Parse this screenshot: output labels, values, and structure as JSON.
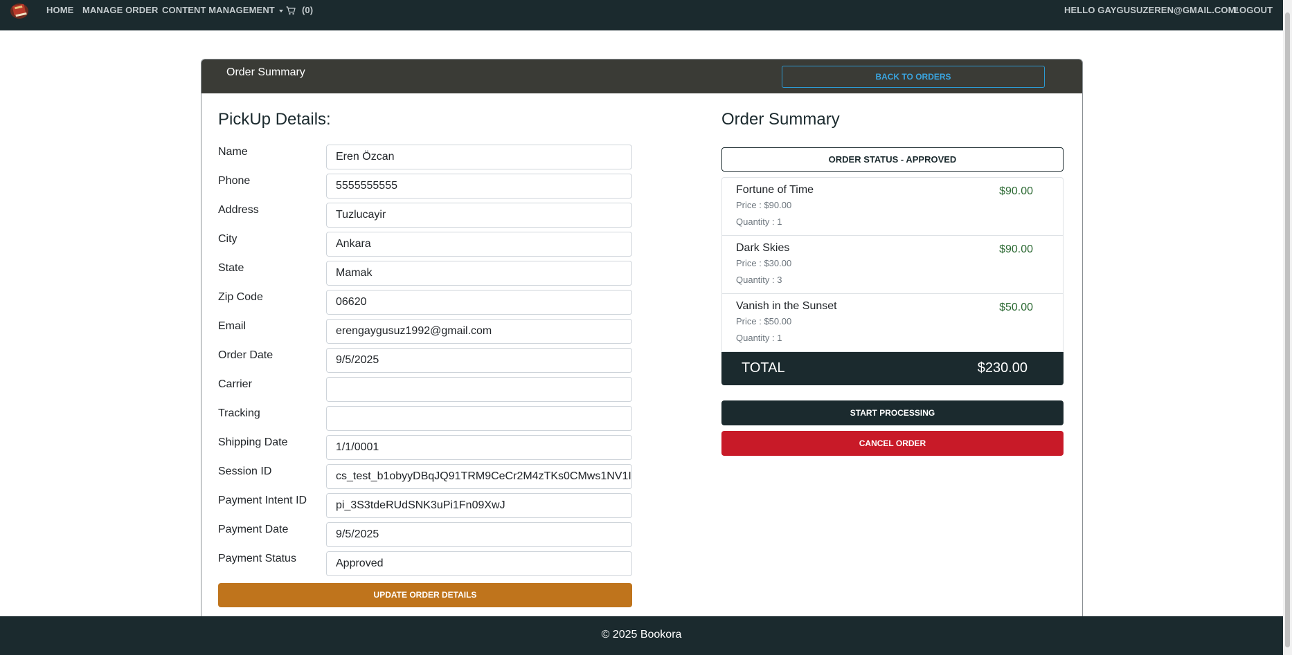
{
  "nav": {
    "home": "HOME",
    "manage_order": "MANAGE ORDER",
    "content_management": "CONTENT MANAGEMENT",
    "cart_count": "(0)",
    "greeting": "HELLO GAYGUSUZEREN@GMAIL.COM!",
    "logout": "LOGOUT"
  },
  "card": {
    "title": "Order Summary",
    "back_button": "BACK TO ORDERS"
  },
  "pickup": {
    "heading": "PickUp Details:",
    "fields": [
      {
        "label": "Name",
        "value": "Eren Özcan"
      },
      {
        "label": "Phone",
        "value": "5555555555"
      },
      {
        "label": "Address",
        "value": "Tuzlucayir"
      },
      {
        "label": "City",
        "value": "Ankara"
      },
      {
        "label": "State",
        "value": "Mamak"
      },
      {
        "label": "Zip Code",
        "value": "06620"
      },
      {
        "label": "Email",
        "value": "erengaygusuz1992@gmail.com"
      },
      {
        "label": "Order Date",
        "value": "9/5/2025"
      },
      {
        "label": "Carrier",
        "value": ""
      },
      {
        "label": "Tracking",
        "value": ""
      },
      {
        "label": "Shipping Date",
        "value": "1/1/0001"
      },
      {
        "label": "Session ID",
        "value": "cs_test_b1obyyDBqJQ91TRM9CeCr2M4zTKs0CMws1NV1I"
      },
      {
        "label": "Payment Intent ID",
        "value": "pi_3S3tdeRUdSNK3uPi1Fn09XwJ"
      },
      {
        "label": "Payment Date",
        "value": "9/5/2025"
      },
      {
        "label": "Payment Status",
        "value": "Approved"
      }
    ],
    "update_button": "UPDATE ORDER DETAILS"
  },
  "summary": {
    "heading": "Order Summary",
    "status": "ORDER STATUS - APPROVED",
    "items": [
      {
        "name": "Fortune of Time",
        "price": "Price : $90.00",
        "quantity": "Quantity : 1",
        "total": "$90.00"
      },
      {
        "name": "Dark Skies",
        "price": "Price : $30.00",
        "quantity": "Quantity : 3",
        "total": "$90.00"
      },
      {
        "name": "Vanish in the Sunset",
        "price": "Price : $50.00",
        "quantity": "Quantity : 1",
        "total": "$50.00"
      }
    ],
    "total_label": "TOTAL",
    "total_value": "$230.00",
    "start_processing": "START PROCESSING",
    "cancel_order": "CANCEL ORDER"
  },
  "footer": {
    "text": "© 2025 Bookora"
  },
  "colors": {
    "navbar": "#1b2a2e",
    "card_header": "#3a3b36",
    "update_button": "#bf741c",
    "cancel_button": "#c81a28",
    "item_total": "#2e6b35",
    "back_button_outline": "#2c9ad3"
  },
  "icons": {
    "logo": "book-logo-icon",
    "cart": "cart-icon",
    "dropdown": "caret-down-icon"
  }
}
